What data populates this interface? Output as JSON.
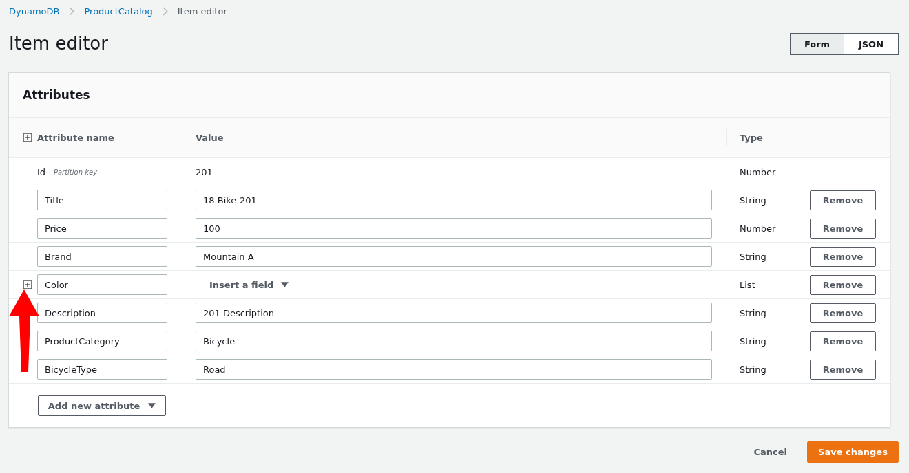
{
  "breadcrumb": [
    {
      "label": "DynamoDB",
      "link": true
    },
    {
      "label": "ProductCatalog",
      "link": true
    },
    {
      "label": "Item editor",
      "link": false
    }
  ],
  "page_title": "Item editor",
  "view_toggle": [
    {
      "label": "Form",
      "selected": true
    },
    {
      "label": "JSON",
      "selected": false
    }
  ],
  "panel": {
    "title": "Attributes",
    "columns": [
      "Attribute name",
      "Value",
      "Type"
    ],
    "rows": [
      {
        "kind": "key",
        "name": "Id",
        "note": "- Partition key",
        "value": "201",
        "type": "Number"
      },
      {
        "kind": "text",
        "name": "Title",
        "value": "18-Bike-201",
        "type": "String",
        "action": "Remove"
      },
      {
        "kind": "text",
        "name": "Price",
        "value": "100",
        "type": "Number",
        "action": "Remove"
      },
      {
        "kind": "text",
        "name": "Brand",
        "value": "Mountain A",
        "type": "String",
        "action": "Remove"
      },
      {
        "kind": "list",
        "name": "Color",
        "value": "Insert a field",
        "type": "List",
        "action": "Remove"
      },
      {
        "kind": "text",
        "name": "Description",
        "value": "201 Description",
        "type": "String",
        "action": "Remove"
      },
      {
        "kind": "text",
        "name": "ProductCategory",
        "value": "Bicycle",
        "type": "String",
        "action": "Remove"
      },
      {
        "kind": "text",
        "name": "BicycleType",
        "value": "Road",
        "type": "String",
        "action": "Remove"
      }
    ],
    "add_button": "Add new attribute"
  },
  "footer": {
    "cancel": "Cancel",
    "save": "Save changes"
  }
}
